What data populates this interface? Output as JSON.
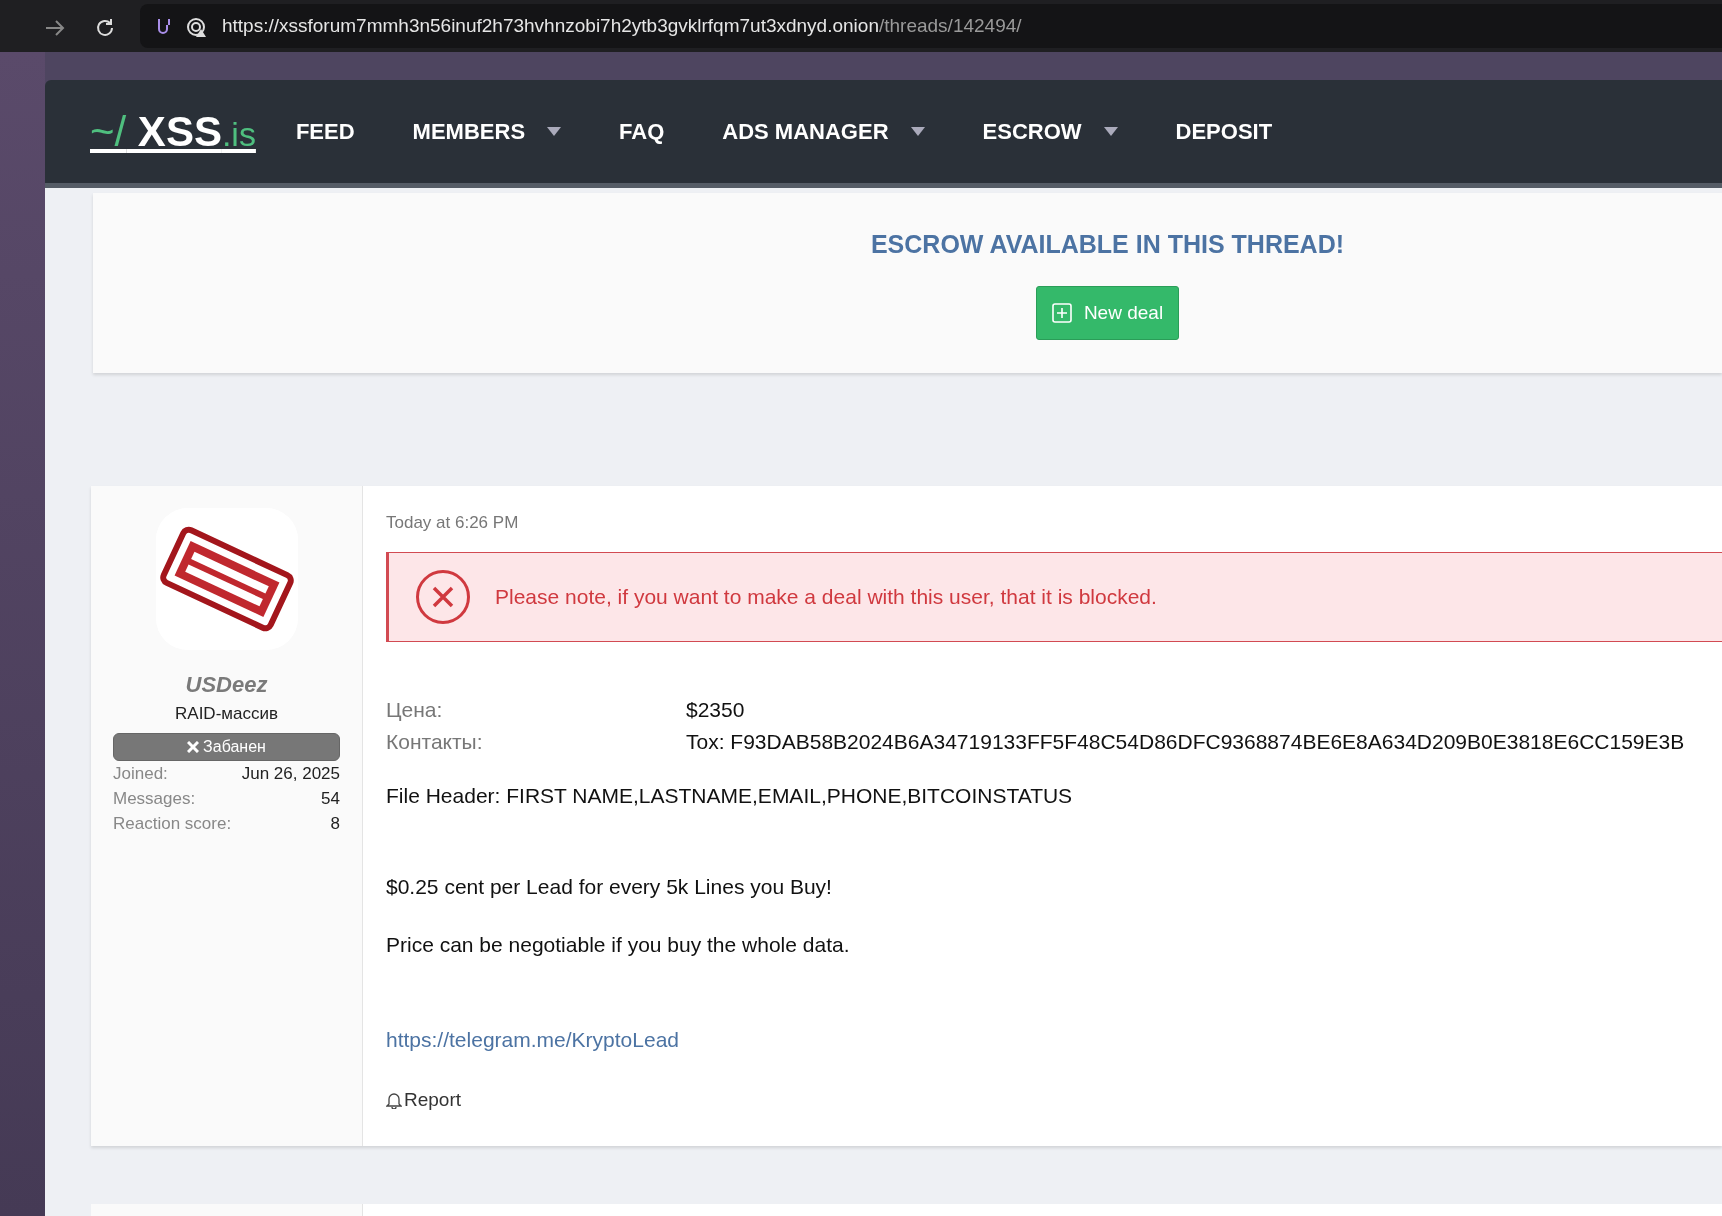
{
  "browser": {
    "url_host": "https://xssforum7mmh3n56inuf2h73hvhnzobi7h2ytb3gvklrfqm7ut3xdnyd.onion",
    "url_path": "/threads/142494/"
  },
  "navbar": {
    "logo_prefix": "~/",
    "logo_name": "XSS",
    "logo_suffix": ".is",
    "items": [
      {
        "label": "FEED",
        "dropdown": false
      },
      {
        "label": "MEMBERS",
        "dropdown": true
      },
      {
        "label": "FAQ",
        "dropdown": false
      },
      {
        "label": "ADS MANAGER",
        "dropdown": true
      },
      {
        "label": "ESCROW",
        "dropdown": true
      },
      {
        "label": "DEPOSIT",
        "dropdown": false
      }
    ]
  },
  "escrow": {
    "title": "ESCROW AVAILABLE IN THIS THREAD!",
    "button": "New deal"
  },
  "post": {
    "user": {
      "name": "USDeez",
      "title": "RAID-массив",
      "banner": "Забанен",
      "stats": [
        {
          "label": "Joined:",
          "value": "Jun 26, 2025"
        },
        {
          "label": "Messages:",
          "value": "54"
        },
        {
          "label": "Reaction score:",
          "value": "8"
        }
      ]
    },
    "date": "Today at 6:26 PM",
    "alert": "Please note, if you want to make a deal with this user, that it is blocked.",
    "fields": [
      {
        "label": "Цена:",
        "value": "$2350"
      },
      {
        "label": "Контакты:",
        "value": "Tox: F93DAB58B2024B6A34719133FF5F48C54D86DFC9368874BE6E8A634D209B0E3818E6CC159E3B"
      }
    ],
    "paragraphs": [
      "File Header: FIRST NAME,LASTNAME,EMAIL,PHONE,BITCOINSTATUS",
      "$0.25 cent per Lead for every 5k Lines you Buy!",
      "Price can be negotiable if you buy the whole data."
    ],
    "link": "https://telegram.me/KryptoLead",
    "report": "Report"
  }
}
